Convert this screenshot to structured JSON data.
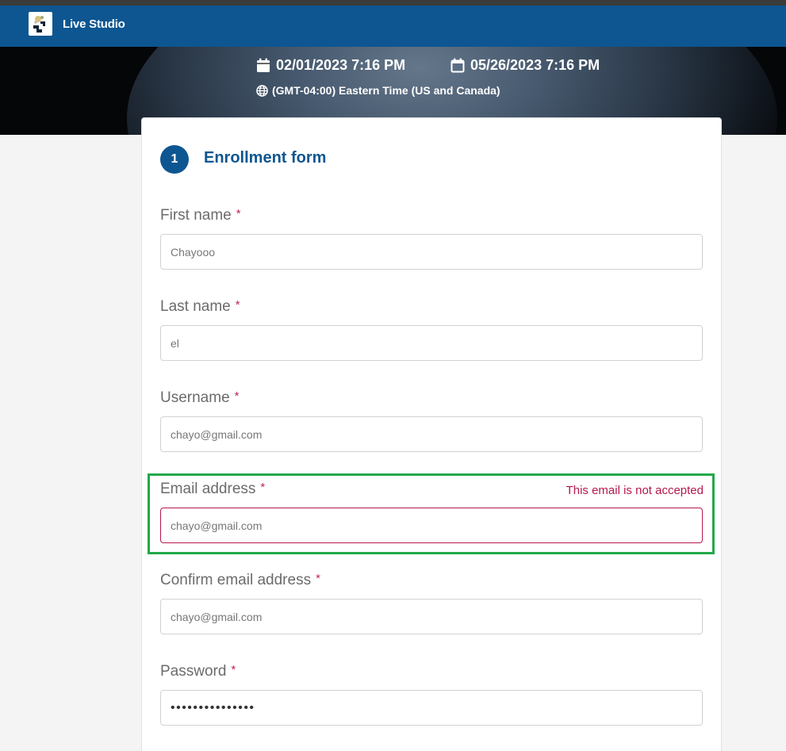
{
  "app": {
    "title": "Live Studio",
    "brand_color": "#0d5691"
  },
  "event": {
    "start": "02/01/2023 7:16 PM",
    "end": "05/26/2023 7:16 PM",
    "timezone": "(GMT-04:00) Eastern Time (US and Canada)"
  },
  "form": {
    "step_number": "1",
    "step_title": "Enrollment form",
    "required_mark": "*",
    "fields": [
      {
        "label": "First name",
        "value": "Chayooo"
      },
      {
        "label": "Last name",
        "value": "el"
      },
      {
        "label": "Username",
        "value": "chayo@gmail.com"
      },
      {
        "label": "Email address",
        "value": "chayo@gmail.com",
        "error": "This email is not accepted"
      },
      {
        "label": "Confirm email address",
        "value": "chayo@gmail.com"
      },
      {
        "label": "Password",
        "value": "•••••••••••••••"
      }
    ]
  },
  "colors": {
    "error": "#b5184a",
    "highlight": "#22a84a"
  }
}
